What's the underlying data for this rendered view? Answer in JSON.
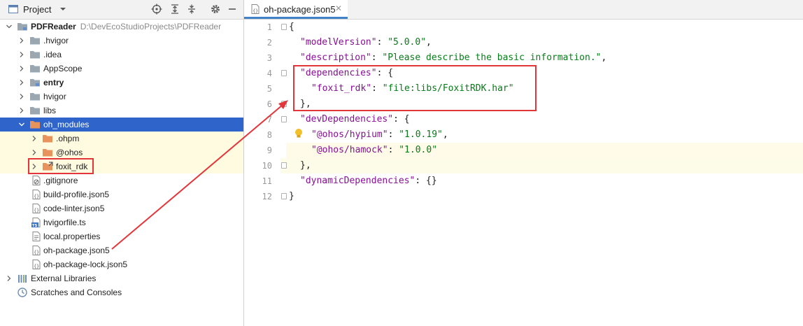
{
  "project_panel": {
    "title": "Project",
    "tree": [
      {
        "label": "PDFReader",
        "path": "D:\\DevEcoStudioProjects\\PDFReader"
      },
      {
        "label": ".hvigor"
      },
      {
        "label": ".idea"
      },
      {
        "label": "AppScope"
      },
      {
        "label": "entry"
      },
      {
        "label": "hvigor"
      },
      {
        "label": "libs"
      },
      {
        "label": "oh_modules"
      },
      {
        "label": ".ohpm"
      },
      {
        "label": "@ohos"
      },
      {
        "label": "foxit_rdk"
      },
      {
        "label": ".gitignore"
      },
      {
        "label": "build-profile.json5"
      },
      {
        "label": "code-linter.json5"
      },
      {
        "label": "hvigorfile.ts"
      },
      {
        "label": "local.properties"
      },
      {
        "label": "oh-package.json5"
      },
      {
        "label": "oh-package-lock.json5"
      },
      {
        "label": "External Libraries"
      },
      {
        "label": "Scratches and Consoles"
      }
    ]
  },
  "editor": {
    "tab_label": "oh-package.json5",
    "line_numbers": [
      "1",
      "2",
      "3",
      "4",
      "5",
      "6",
      "7",
      "8",
      "9",
      "10",
      "11",
      "12"
    ],
    "lines": {
      "l1": "{",
      "l2_key": "\"modelVersion\"",
      "l2_val": "\"5.0.0\"",
      "l3_key": "\"description\"",
      "l3_val": "\"Please describe the basic information.\"",
      "l4_key": "\"dependencies\"",
      "l5_key": "\"foxit_rdk\"",
      "l5_val": "\"file:libs/FoxitRDK.har\"",
      "l6": "},",
      "l7_key": "\"devDependencies\"",
      "l8_key": "\"@ohos/hypium\"",
      "l8_val": "\"1.0.19\"",
      "l9_key": "\"@ohos/hamock\"",
      "l9_val": "\"1.0.0\"",
      "l10": "},",
      "l11_key": "\"dynamicDependencies\"",
      "l11_rest": ": {}",
      "l12": "}"
    }
  },
  "colors": {
    "selection": "#2f65ca",
    "annotation": "#e2363a",
    "key": "#871094",
    "string": "#067d17"
  }
}
